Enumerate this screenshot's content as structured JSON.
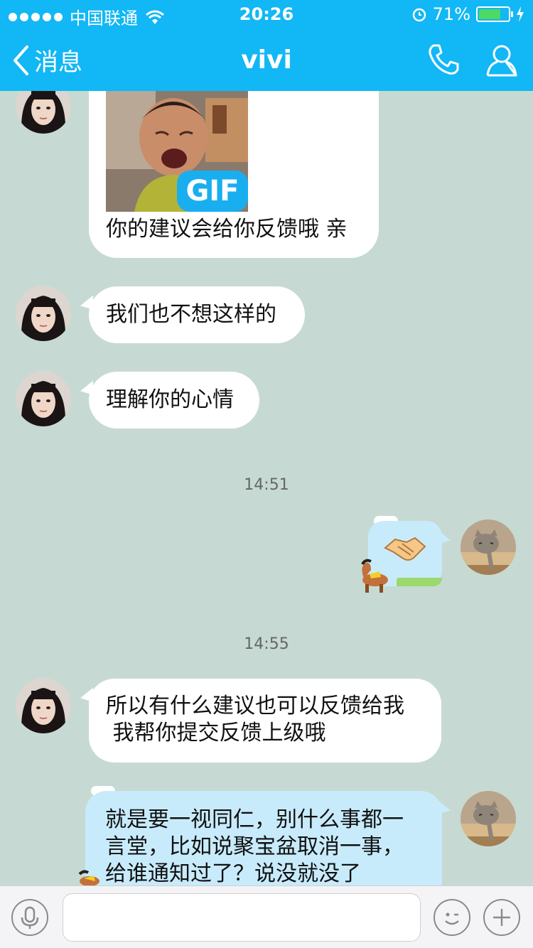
{
  "status_bar": {
    "carrier": "中国联通",
    "time": "20:26",
    "battery_percent": "71%",
    "battery_level": 0.71
  },
  "nav": {
    "back_label": "消息",
    "title": "vivi"
  },
  "chat": {
    "messages": [
      {
        "side": "left",
        "text": "你的建议会给你反馈哦 亲",
        "gif_badge": "GIF"
      },
      {
        "side": "left",
        "text": "我们也不想这样的"
      },
      {
        "side": "left",
        "text": "理解你的心情"
      },
      {
        "timestamp": "14:51"
      },
      {
        "side": "right",
        "sticker": "handshake-sticker"
      },
      {
        "timestamp": "14:55"
      },
      {
        "side": "left",
        "lines": [
          "所以有什么建议也可以反馈给我",
          " 我帮你提交反馈上级哦"
        ]
      },
      {
        "side": "right",
        "lines": [
          "就是要一视同仁，别什么事都一",
          "言堂，比如说聚宝盆取消一事，",
          "给谁通知过了？说没就没了"
        ]
      }
    ]
  },
  "colors": {
    "nav_blue": "#12b7f5",
    "chat_bg": "#c6dad3",
    "bubble_right": "#c8ebfc",
    "battery_green": "#4cd964"
  }
}
